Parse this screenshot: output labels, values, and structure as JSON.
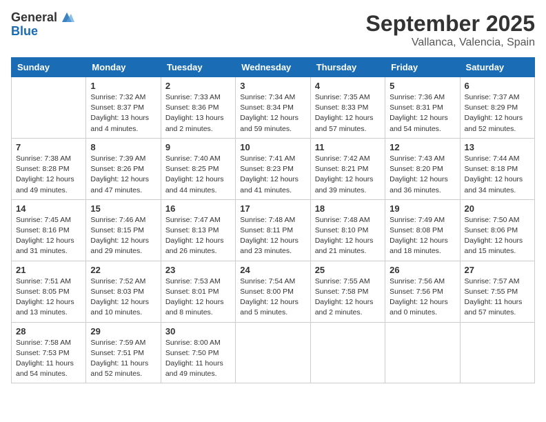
{
  "logo": {
    "general": "General",
    "blue": "Blue"
  },
  "title": "September 2025",
  "location": "Vallanca, Valencia, Spain",
  "days_of_week": [
    "Sunday",
    "Monday",
    "Tuesday",
    "Wednesday",
    "Thursday",
    "Friday",
    "Saturday"
  ],
  "weeks": [
    [
      {
        "day": "",
        "sunrise": "",
        "sunset": "",
        "daylight": ""
      },
      {
        "day": "1",
        "sunrise": "Sunrise: 7:32 AM",
        "sunset": "Sunset: 8:37 PM",
        "daylight": "Daylight: 13 hours and 4 minutes."
      },
      {
        "day": "2",
        "sunrise": "Sunrise: 7:33 AM",
        "sunset": "Sunset: 8:36 PM",
        "daylight": "Daylight: 13 hours and 2 minutes."
      },
      {
        "day": "3",
        "sunrise": "Sunrise: 7:34 AM",
        "sunset": "Sunset: 8:34 PM",
        "daylight": "Daylight: 12 hours and 59 minutes."
      },
      {
        "day": "4",
        "sunrise": "Sunrise: 7:35 AM",
        "sunset": "Sunset: 8:33 PM",
        "daylight": "Daylight: 12 hours and 57 minutes."
      },
      {
        "day": "5",
        "sunrise": "Sunrise: 7:36 AM",
        "sunset": "Sunset: 8:31 PM",
        "daylight": "Daylight: 12 hours and 54 minutes."
      },
      {
        "day": "6",
        "sunrise": "Sunrise: 7:37 AM",
        "sunset": "Sunset: 8:29 PM",
        "daylight": "Daylight: 12 hours and 52 minutes."
      }
    ],
    [
      {
        "day": "7",
        "sunrise": "Sunrise: 7:38 AM",
        "sunset": "Sunset: 8:28 PM",
        "daylight": "Daylight: 12 hours and 49 minutes."
      },
      {
        "day": "8",
        "sunrise": "Sunrise: 7:39 AM",
        "sunset": "Sunset: 8:26 PM",
        "daylight": "Daylight: 12 hours and 47 minutes."
      },
      {
        "day": "9",
        "sunrise": "Sunrise: 7:40 AM",
        "sunset": "Sunset: 8:25 PM",
        "daylight": "Daylight: 12 hours and 44 minutes."
      },
      {
        "day": "10",
        "sunrise": "Sunrise: 7:41 AM",
        "sunset": "Sunset: 8:23 PM",
        "daylight": "Daylight: 12 hours and 41 minutes."
      },
      {
        "day": "11",
        "sunrise": "Sunrise: 7:42 AM",
        "sunset": "Sunset: 8:21 PM",
        "daylight": "Daylight: 12 hours and 39 minutes."
      },
      {
        "day": "12",
        "sunrise": "Sunrise: 7:43 AM",
        "sunset": "Sunset: 8:20 PM",
        "daylight": "Daylight: 12 hours and 36 minutes."
      },
      {
        "day": "13",
        "sunrise": "Sunrise: 7:44 AM",
        "sunset": "Sunset: 8:18 PM",
        "daylight": "Daylight: 12 hours and 34 minutes."
      }
    ],
    [
      {
        "day": "14",
        "sunrise": "Sunrise: 7:45 AM",
        "sunset": "Sunset: 8:16 PM",
        "daylight": "Daylight: 12 hours and 31 minutes."
      },
      {
        "day": "15",
        "sunrise": "Sunrise: 7:46 AM",
        "sunset": "Sunset: 8:15 PM",
        "daylight": "Daylight: 12 hours and 29 minutes."
      },
      {
        "day": "16",
        "sunrise": "Sunrise: 7:47 AM",
        "sunset": "Sunset: 8:13 PM",
        "daylight": "Daylight: 12 hours and 26 minutes."
      },
      {
        "day": "17",
        "sunrise": "Sunrise: 7:48 AM",
        "sunset": "Sunset: 8:11 PM",
        "daylight": "Daylight: 12 hours and 23 minutes."
      },
      {
        "day": "18",
        "sunrise": "Sunrise: 7:48 AM",
        "sunset": "Sunset: 8:10 PM",
        "daylight": "Daylight: 12 hours and 21 minutes."
      },
      {
        "day": "19",
        "sunrise": "Sunrise: 7:49 AM",
        "sunset": "Sunset: 8:08 PM",
        "daylight": "Daylight: 12 hours and 18 minutes."
      },
      {
        "day": "20",
        "sunrise": "Sunrise: 7:50 AM",
        "sunset": "Sunset: 8:06 PM",
        "daylight": "Daylight: 12 hours and 15 minutes."
      }
    ],
    [
      {
        "day": "21",
        "sunrise": "Sunrise: 7:51 AM",
        "sunset": "Sunset: 8:05 PM",
        "daylight": "Daylight: 12 hours and 13 minutes."
      },
      {
        "day": "22",
        "sunrise": "Sunrise: 7:52 AM",
        "sunset": "Sunset: 8:03 PM",
        "daylight": "Daylight: 12 hours and 10 minutes."
      },
      {
        "day": "23",
        "sunrise": "Sunrise: 7:53 AM",
        "sunset": "Sunset: 8:01 PM",
        "daylight": "Daylight: 12 hours and 8 minutes."
      },
      {
        "day": "24",
        "sunrise": "Sunrise: 7:54 AM",
        "sunset": "Sunset: 8:00 PM",
        "daylight": "Daylight: 12 hours and 5 minutes."
      },
      {
        "day": "25",
        "sunrise": "Sunrise: 7:55 AM",
        "sunset": "Sunset: 7:58 PM",
        "daylight": "Daylight: 12 hours and 2 minutes."
      },
      {
        "day": "26",
        "sunrise": "Sunrise: 7:56 AM",
        "sunset": "Sunset: 7:56 PM",
        "daylight": "Daylight: 12 hours and 0 minutes."
      },
      {
        "day": "27",
        "sunrise": "Sunrise: 7:57 AM",
        "sunset": "Sunset: 7:55 PM",
        "daylight": "Daylight: 11 hours and 57 minutes."
      }
    ],
    [
      {
        "day": "28",
        "sunrise": "Sunrise: 7:58 AM",
        "sunset": "Sunset: 7:53 PM",
        "daylight": "Daylight: 11 hours and 54 minutes."
      },
      {
        "day": "29",
        "sunrise": "Sunrise: 7:59 AM",
        "sunset": "Sunset: 7:51 PM",
        "daylight": "Daylight: 11 hours and 52 minutes."
      },
      {
        "day": "30",
        "sunrise": "Sunrise: 8:00 AM",
        "sunset": "Sunset: 7:50 PM",
        "daylight": "Daylight: 11 hours and 49 minutes."
      },
      {
        "day": "",
        "sunrise": "",
        "sunset": "",
        "daylight": ""
      },
      {
        "day": "",
        "sunrise": "",
        "sunset": "",
        "daylight": ""
      },
      {
        "day": "",
        "sunrise": "",
        "sunset": "",
        "daylight": ""
      },
      {
        "day": "",
        "sunrise": "",
        "sunset": "",
        "daylight": ""
      }
    ]
  ]
}
